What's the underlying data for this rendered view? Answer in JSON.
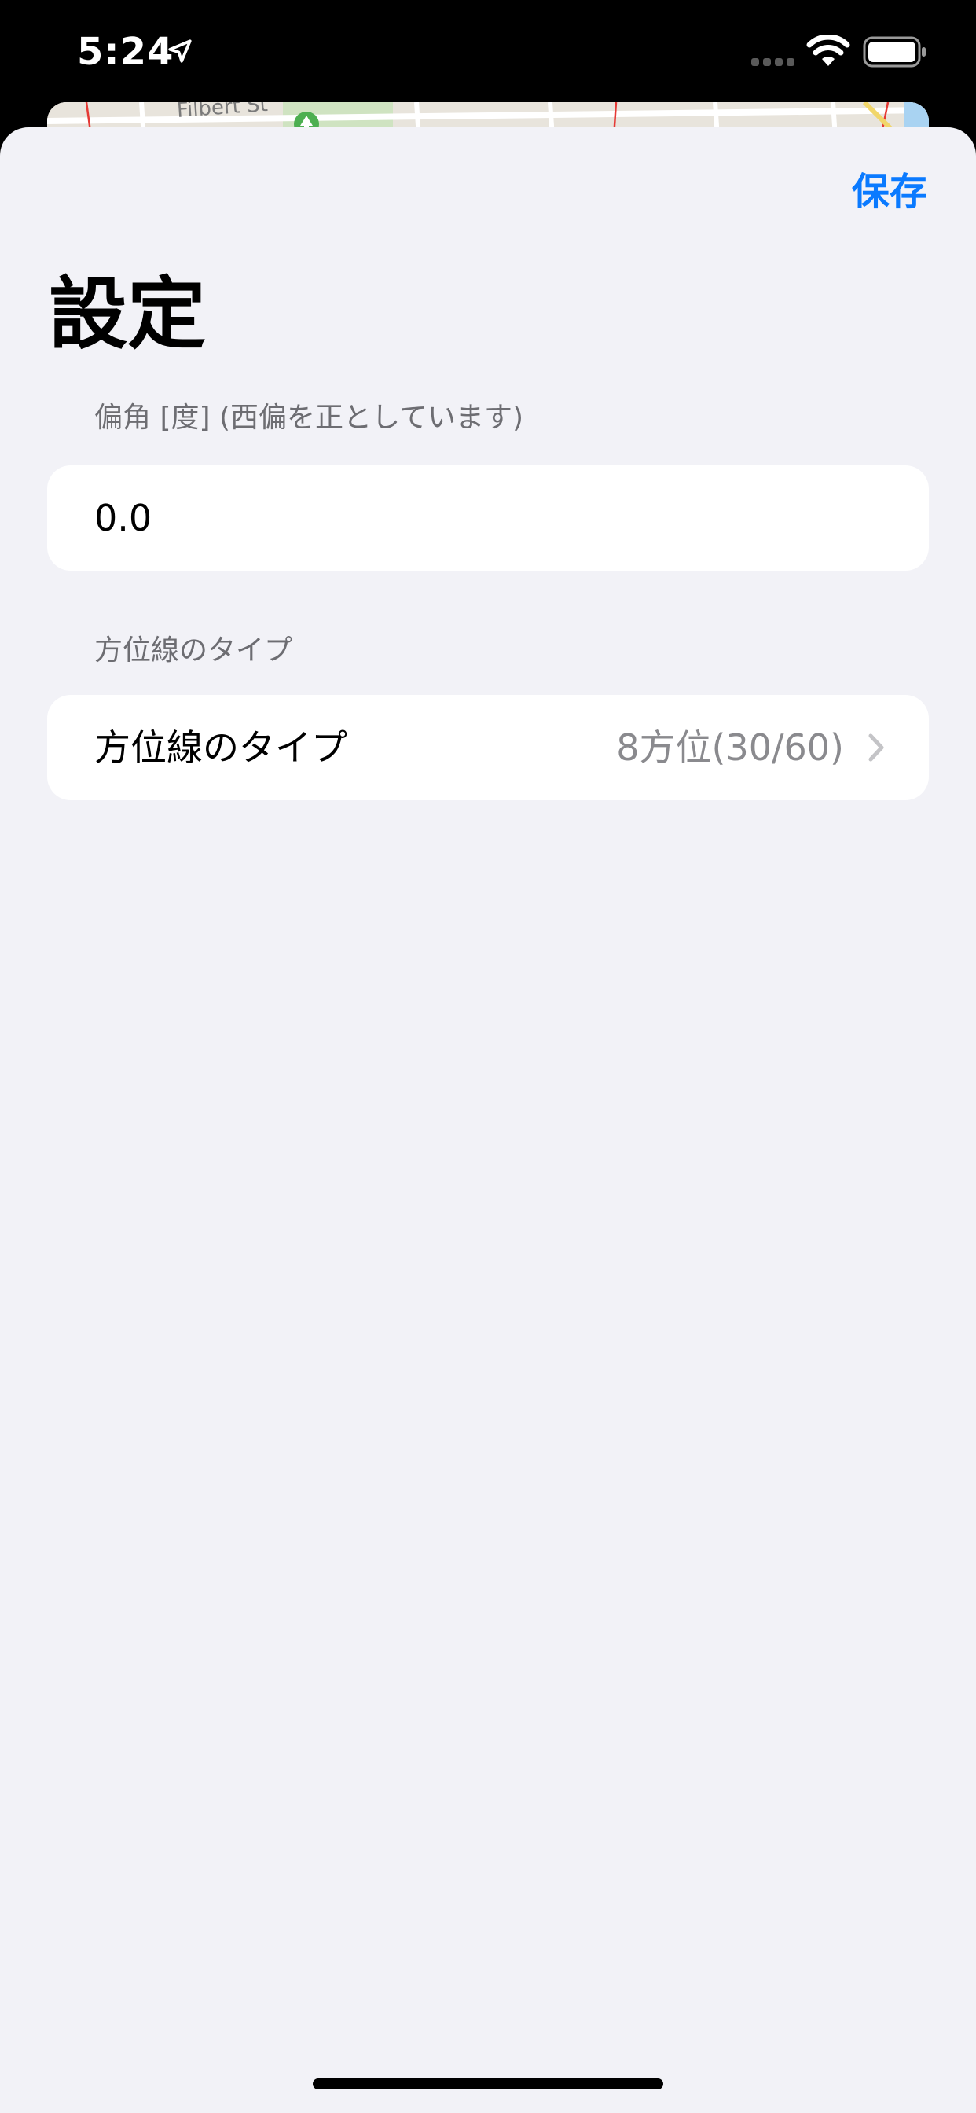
{
  "status_bar": {
    "time": "5:24",
    "icons": [
      "location-arrow-icon",
      "cellular-signal-icon",
      "wifi-icon",
      "battery-icon"
    ]
  },
  "background_map": {
    "street_label": "Filbert St",
    "icons": [
      "park-icon"
    ]
  },
  "header": {
    "save_label": "保存",
    "title": "設定"
  },
  "declination_section": {
    "header": "偏角 [度] (西偏を正としています)",
    "value": "0.0"
  },
  "bearing_section": {
    "header": "方位線のタイプ",
    "row_label": "方位線のタイプ",
    "row_value": "8方位(30/60)",
    "icon": "chevron-right-icon"
  },
  "colors": {
    "accent": "#0a7aff",
    "background": "#f2f2f7",
    "cell": "#ffffff",
    "secondary_text": "#6d6d72"
  }
}
